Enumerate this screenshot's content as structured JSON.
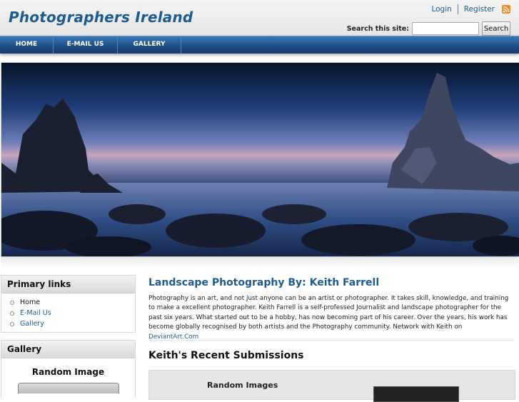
{
  "site": {
    "title": "Photographers Ireland"
  },
  "user_links": {
    "login": "Login",
    "register": "Register"
  },
  "search": {
    "label": "Search this site:",
    "value": "",
    "button": "Search"
  },
  "nav": {
    "items": [
      {
        "label": "HOME"
      },
      {
        "label": "E-MAIL US"
      },
      {
        "label": "GALLERY"
      }
    ]
  },
  "sidebar": {
    "primary_links": {
      "title": "Primary links",
      "items": [
        {
          "label": "Home"
        },
        {
          "label": "E-Mail Us"
        },
        {
          "label": "Gallery"
        }
      ]
    },
    "gallery": {
      "title": "Gallery",
      "random_title": "Random Image"
    }
  },
  "main": {
    "title": "Landscape Photography By: Keith Farrell",
    "body": "Photography is an art, and not just anyone can be an artist or photographer. It takes skill, knowledge, and training to make a excellent photographer. Keith Farrell is a self-professed Journalist and landscape photographer for the past six years. What started out to be a hobby, has now becoming part of his career. Over the years, his work has become globally recognised by both artists and the Photography community. Network with Keith on ",
    "link": "DeviantArt.Com",
    "submissions_title": "Keith's Recent Submissions",
    "random_images_title": "Random Images"
  },
  "colors": {
    "brand": "#1e5c8f",
    "nav_dark": "#163f6c",
    "rss": "#f28c1e"
  },
  "icons": [
    "rss-icon"
  ]
}
